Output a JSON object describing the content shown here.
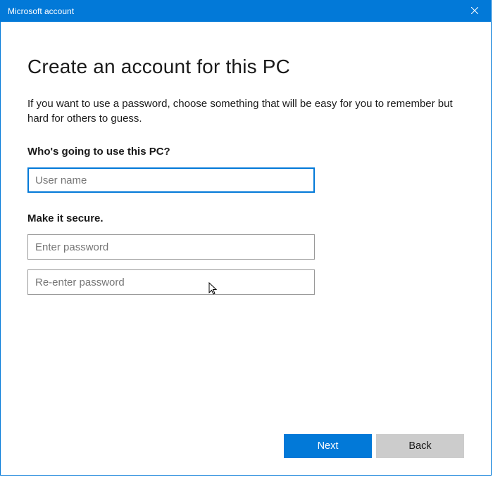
{
  "window": {
    "title": "Microsoft account"
  },
  "page": {
    "heading": "Create an account for this PC",
    "description": "If you want to use a password, choose something that will be easy for you to remember but hard for others to guess."
  },
  "section_user": {
    "label": "Who's going to use this PC?",
    "username": {
      "value": "",
      "placeholder": "User name"
    }
  },
  "section_secure": {
    "label": "Make it secure.",
    "password": {
      "value": "",
      "placeholder": "Enter password"
    },
    "password_confirm": {
      "value": "",
      "placeholder": "Re-enter password"
    }
  },
  "footer": {
    "next_label": "Next",
    "back_label": "Back"
  },
  "colors": {
    "accent": "#0279d8",
    "secondary_button": "#cccccc",
    "text": "#1a1a1a",
    "placeholder": "#767676"
  }
}
